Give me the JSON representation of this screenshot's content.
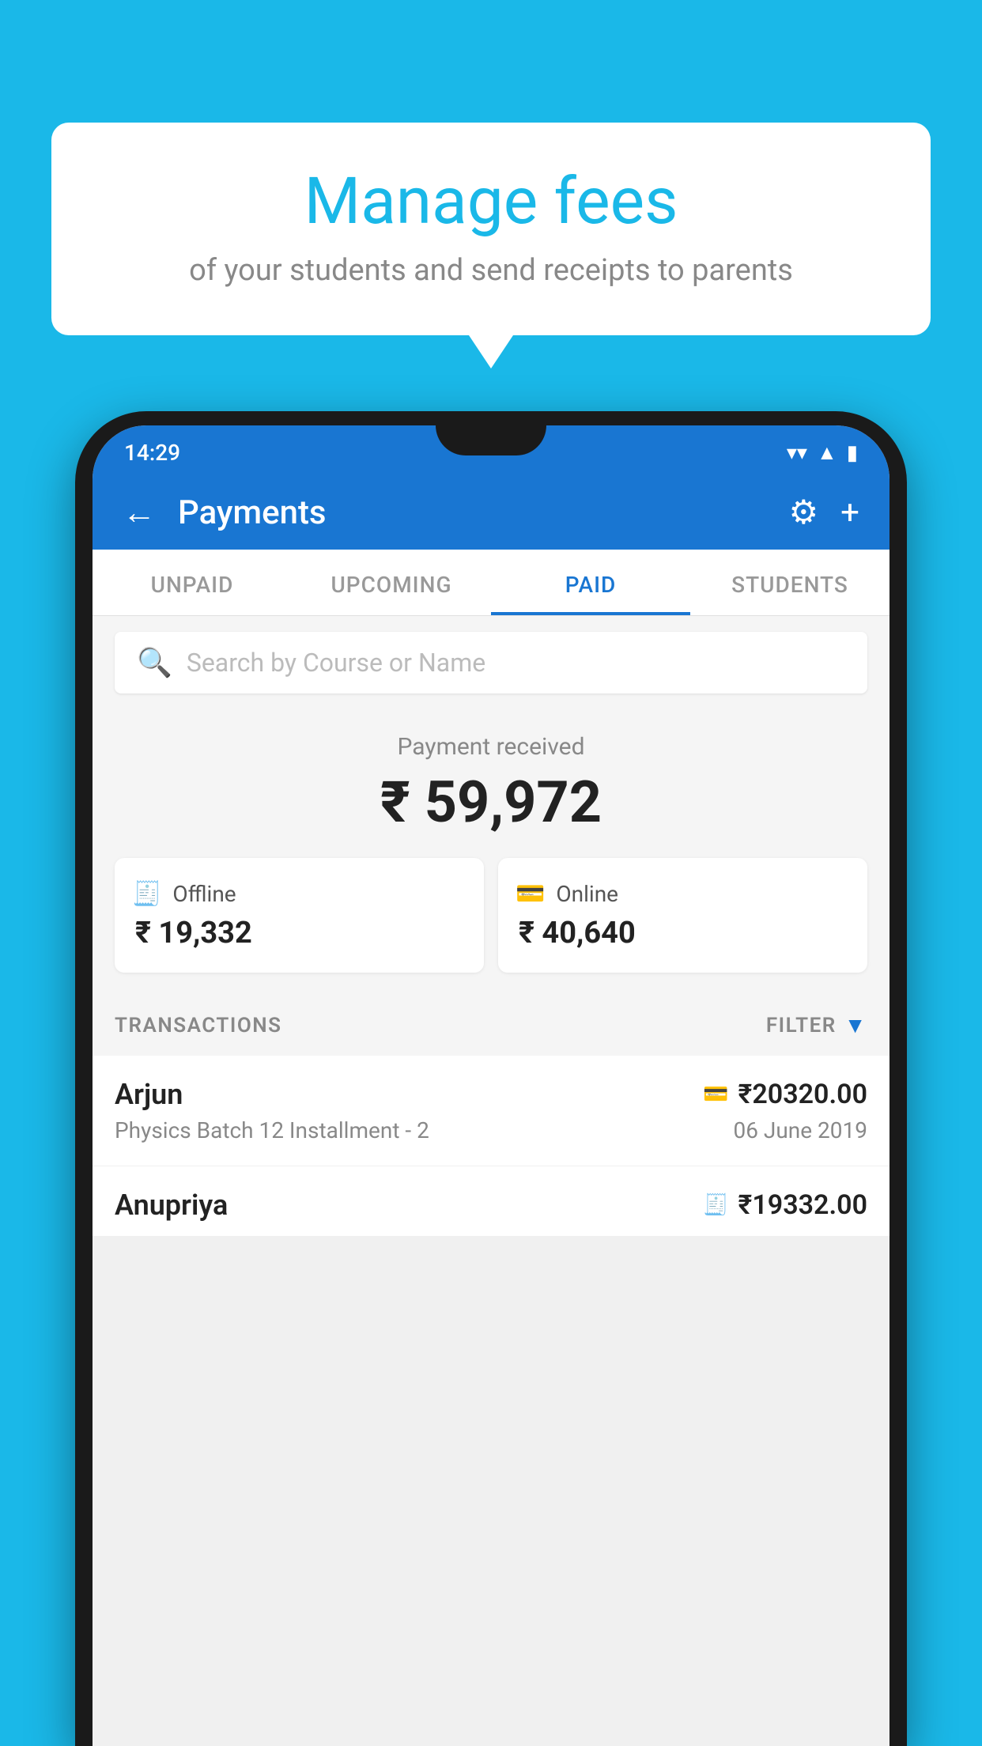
{
  "background_color": "#1ab8e8",
  "bubble": {
    "title": "Manage fees",
    "subtitle": "of your students and send receipts to parents"
  },
  "status_bar": {
    "time": "14:29"
  },
  "app_bar": {
    "title": "Payments",
    "back_label": "←",
    "gear_label": "⚙",
    "plus_label": "+"
  },
  "tabs": [
    {
      "id": "unpaid",
      "label": "UNPAID",
      "active": false
    },
    {
      "id": "upcoming",
      "label": "UPCOMING",
      "active": false
    },
    {
      "id": "paid",
      "label": "PAID",
      "active": true
    },
    {
      "id": "students",
      "label": "STUDENTS",
      "active": false
    }
  ],
  "search": {
    "placeholder": "Search by Course or Name"
  },
  "payment_summary": {
    "label": "Payment received",
    "amount": "₹ 59,972",
    "offline": {
      "icon": "💳",
      "label": "Offline",
      "amount": "₹ 19,332"
    },
    "online": {
      "icon": "💳",
      "label": "Online",
      "amount": "₹ 40,640"
    }
  },
  "transactions": {
    "header": "TRANSACTIONS",
    "filter_label": "FILTER",
    "rows": [
      {
        "name": "Arjun",
        "type_icon": "💳",
        "amount": "₹20320.00",
        "course": "Physics Batch 12 Installment - 2",
        "date": "06 June 2019"
      },
      {
        "name": "Anupriya",
        "type_icon": "💵",
        "amount": "₹19332.00",
        "course": "",
        "date": ""
      }
    ]
  }
}
